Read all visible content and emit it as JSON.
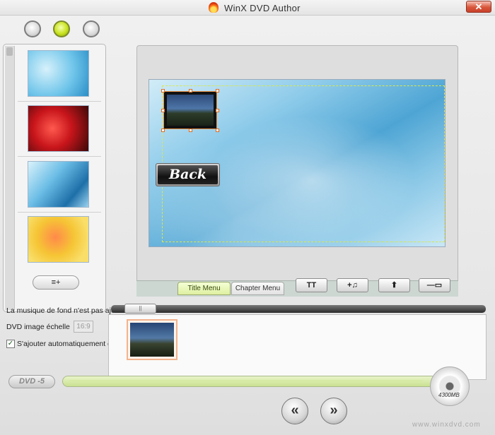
{
  "window": {
    "title": "WinX DVD Author",
    "close_icon": "close-icon"
  },
  "steps": [
    {
      "state": "inactive"
    },
    {
      "state": "active"
    },
    {
      "state": "inactive"
    }
  ],
  "thumbnails": [
    {
      "name": "blue-mosaic-thumbnail"
    },
    {
      "name": "red-roses-thumbnail"
    },
    {
      "name": "blue-light-thumbnail"
    },
    {
      "name": "yellow-flowers-thumbnail"
    }
  ],
  "add_menu_button": {
    "icon": "add-menu-icon",
    "glyph": "≡+"
  },
  "preview": {
    "back_button": "Back"
  },
  "tabs": {
    "title_menu": "Title Menu",
    "chapter_menu": "Chapter Menu"
  },
  "tools": {
    "text": "TT",
    "music": "+♫",
    "upload": "⬆",
    "remove": "—▭"
  },
  "music": {
    "status": "La musique de fond n'est pas ajoutée",
    "knob": "||"
  },
  "scale": {
    "label": "DVD image échelle",
    "value": "16:9"
  },
  "auto_add": {
    "checked": true,
    "label": "S'ajouter automatiquement dans le DVD menu original"
  },
  "disc": {
    "type": "DVD -5",
    "capacity": "4300MB",
    "usage_fraction": 0.98
  },
  "nav": {
    "prev": "«",
    "next": "»"
  },
  "footer": {
    "watermark": "www.winxdvd.com"
  }
}
